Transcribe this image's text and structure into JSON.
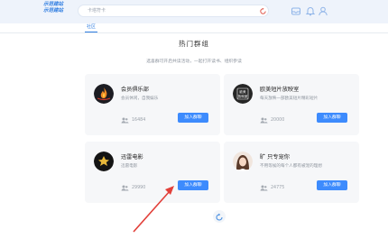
{
  "header": {
    "logo_line1": "示范建站",
    "logo_line2": "示范建站",
    "search_placeholder": "卡塔符卡"
  },
  "tabs": [
    {
      "label": "社区"
    }
  ],
  "main": {
    "title": "热门群组",
    "description": "选喜群可开启共读活动，一起打开读书、组织参读"
  },
  "groups": [
    {
      "name": "会员俱乐部",
      "desc": "会员休闲，自我娱乐",
      "members": "16484",
      "join_label": "加入群聊",
      "avatar": "flame-avatar"
    },
    {
      "name": "欧美短片放映室",
      "desc": "每天放映一部欧美短片精彩短片",
      "members": "20000",
      "join_label": "加入群聊",
      "avatar": "cinema-badge-avatar"
    },
    {
      "name": "迅雷电影",
      "desc": "迅雷电影",
      "members": "29990",
      "join_label": "加入群聊",
      "avatar": "bird-logo-avatar"
    },
    {
      "name": "旷 只专宠你",
      "desc": "不用等候的每个人都有被宠的理想",
      "members": "24775",
      "join_label": "加入群聊",
      "avatar": "girl-portrait-avatar"
    }
  ],
  "avatar_badge_text": "欧美 放映室",
  "colors": {
    "accent": "#3d8bfd",
    "arrow": "#e2403a"
  }
}
